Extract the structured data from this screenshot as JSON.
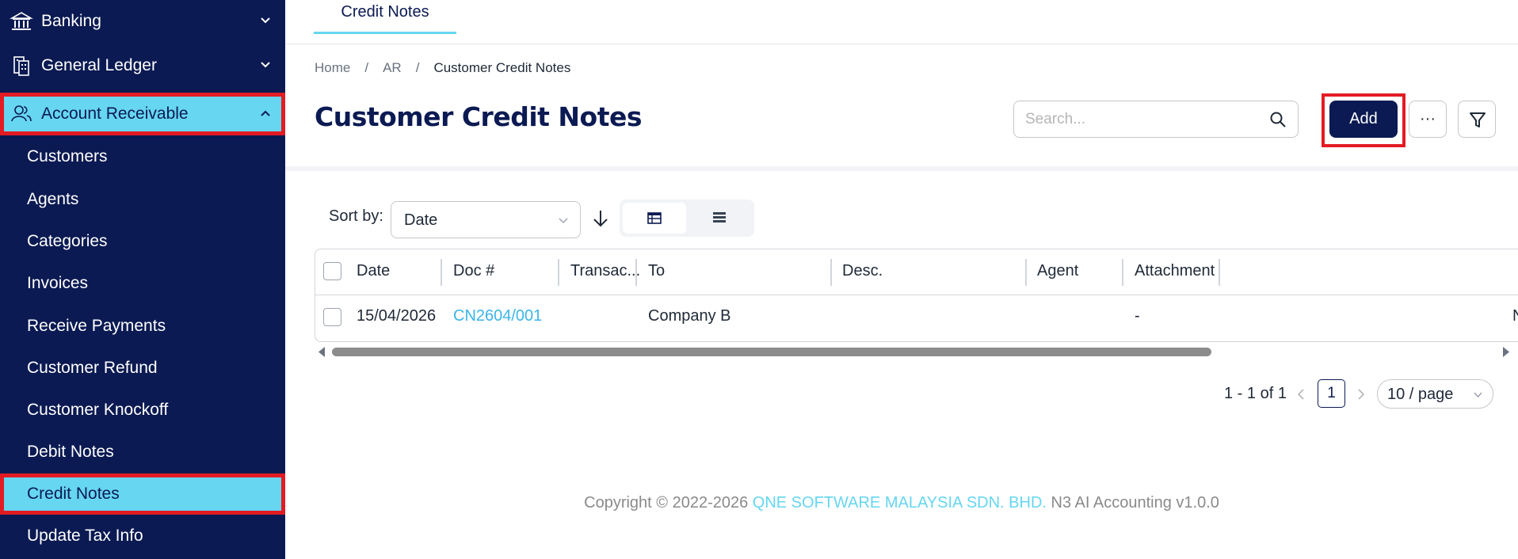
{
  "sidebar": {
    "parents": [
      {
        "label": "Banking",
        "icon": "bank-icon"
      },
      {
        "label": "General Ledger",
        "icon": "ledger-icon"
      },
      {
        "label": "Account Receivable",
        "icon": "users-icon"
      }
    ],
    "children": [
      {
        "label": "Customers"
      },
      {
        "label": "Agents"
      },
      {
        "label": "Categories"
      },
      {
        "label": "Invoices"
      },
      {
        "label": "Receive Payments"
      },
      {
        "label": "Customer Refund"
      },
      {
        "label": "Customer Knockoff"
      },
      {
        "label": "Debit Notes"
      },
      {
        "label": "Credit Notes"
      },
      {
        "label": "Update Tax Info"
      }
    ],
    "active_child": "Credit Notes"
  },
  "tabs": [
    {
      "label": "Credit Notes"
    }
  ],
  "breadcrumb": {
    "home": "Home",
    "section": "AR",
    "current": "Customer Credit Notes"
  },
  "page": {
    "title": "Customer Credit Notes"
  },
  "search": {
    "placeholder": "Search..."
  },
  "toolbar": {
    "add_label": "Add",
    "more_label": "···"
  },
  "sort": {
    "label": "Sort by:",
    "value": "Date"
  },
  "table": {
    "columns": [
      "Date",
      "Doc #",
      "Transac...",
      "To",
      "Desc.",
      "Agent",
      "Attachment"
    ],
    "rows": [
      {
        "date": "15/04/2026",
        "doc": "CN2604/001",
        "transaction": "",
        "to": "Company B",
        "desc": "",
        "agent": "",
        "attachment": "-",
        "overflow": "N"
      }
    ]
  },
  "pagination": {
    "range": "1 - 1 of 1",
    "current": "1",
    "page_size": "10 / page"
  },
  "footer": {
    "prefix": "Copyright © 2022-2026 ",
    "company": "QNE SOFTWARE MALAYSIA SDN. BHD.",
    "suffix": " N3 AI Accounting v1.0.0"
  },
  "colors": {
    "sidebar_bg": "#0b1a52",
    "active_bg": "#66d6f1",
    "highlight": "#e31b23",
    "link": "#3bb5ea"
  }
}
